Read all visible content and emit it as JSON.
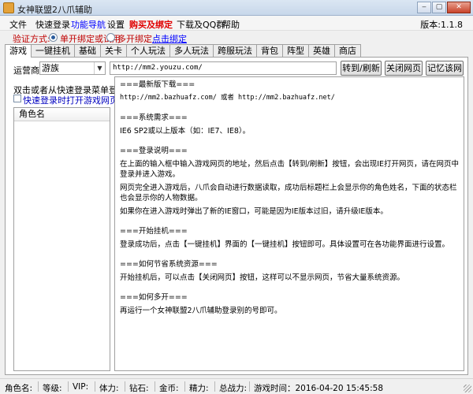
{
  "window": {
    "title": "女神联盟2八爪辅助",
    "min": "‒",
    "max": "▢",
    "close": "✕"
  },
  "menu": {
    "file": "文件",
    "quick_login": "快速登录",
    "nav": "功能导航",
    "settings": "设置",
    "buy": "购买及绑定",
    "download": "下载及QQ群",
    "help": "帮助",
    "version": "版本:1.1.8"
  },
  "verify": {
    "label": "验证方式:",
    "option1": "单开绑定或试用",
    "option2": "多开绑定",
    "link": "点击绑定"
  },
  "tabs": [
    "游戏",
    "一键挂机",
    "基础",
    "关卡",
    "个人玩法",
    "多人玩法",
    "跨服玩法",
    "背包",
    "阵型",
    "英雄",
    "商店"
  ],
  "toolbar": {
    "server_label": "运营商",
    "server_value": "游族",
    "url": "http://mm2.youzu.com/",
    "refresh": "转到/刷新",
    "close_page": "关闭网页",
    "remember": "记忆该网址"
  },
  "left": {
    "hint": "双击或者从快速登录菜单登录",
    "quick_checkbox": "快速登录时打开游戏网页",
    "role_header": "角色名"
  },
  "info": {
    "h1": "===最新版下载===",
    "urls": "http://mm2.bazhuafz.com/ 或者 http://mm2.bazhuafz.net/",
    "h2": "===系统需求===",
    "req": "IE6 SP2或以上版本（如：IE7、IE8）。",
    "h3": "===登录说明===",
    "login1": "在上面的输入框中输入游戏网页的地址，然后点击【转到/刷新】按钮，会出现IE打开网页，请在网页中登录并进入游戏。",
    "login2": "网页完全进入游戏后，八爪会自动进行数据读取，成功后标题栏上会显示你的角色姓名，下面的状态栏也会显示你的人物数据。",
    "login3": "如果你在进入游戏时弹出了新的IE窗口，可能是因为IE版本过旧，请升级IE版本。",
    "h4": "===开始挂机===",
    "start": "登录成功后，点击【一键挂机】界面的【一键挂机】按钮即可。具体设置可在各功能界面进行设置。",
    "h5": "===如何节省系统资源===",
    "save": "开始挂机后，可以点击【关闭网页】按钮，这样可以不显示网页，节省大量系统资源。",
    "h6": "===如何多开===",
    "multi": "再运行一个女神联盟2八爪辅助登录别的号即可。"
  },
  "status": {
    "role": "角色名:",
    "level": "等级:",
    "vip": "VIP:",
    "stamina": "体力:",
    "diamond": "钻石:",
    "gold": "金币:",
    "energy": "精力:",
    "power": "总战力:",
    "time": "游戏时间：2016-04-20 15:45:58"
  }
}
